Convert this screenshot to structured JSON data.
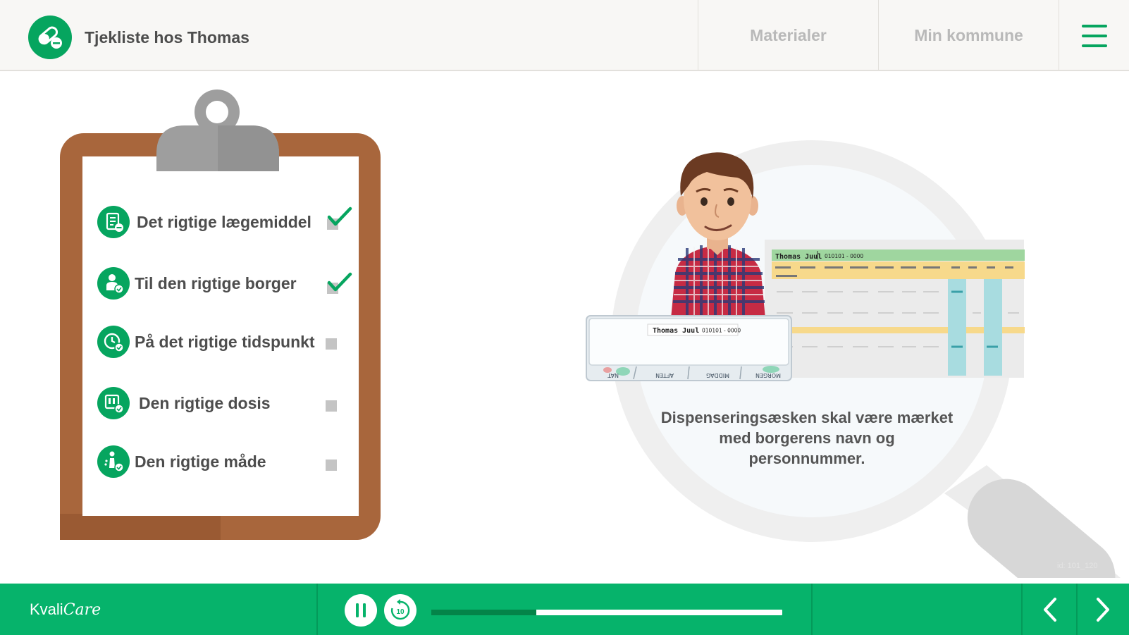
{
  "header": {
    "title": "Tjekliste hos Thomas",
    "nav": {
      "materials": "Materialer",
      "kommune": "Min kommune"
    }
  },
  "checklist": {
    "items": [
      {
        "label": "Det rigtige lægemiddel",
        "checked": true,
        "icon": "medication-list-icon"
      },
      {
        "label": "Til den rigtige borger",
        "checked": true,
        "icon": "citizen-icon"
      },
      {
        "label": "På det rigtige tidspunkt",
        "checked": false,
        "icon": "clock-icon"
      },
      {
        "label": "Den rigtige dosis",
        "checked": false,
        "icon": "dose-icon"
      },
      {
        "label": "Den rigtige måde",
        "checked": false,
        "icon": "person-method-icon"
      }
    ]
  },
  "scene": {
    "caption": "Dispenseringsæsken skal være mærket med borgerens navn og personnummer.",
    "pillbox": {
      "name": "Thomas Juul",
      "cpr": "010101 - 0000",
      "compartments": [
        "NAT",
        "AFTEN",
        "MIDDAG",
        "MORGEN"
      ]
    },
    "card": {
      "name": "Thomas Juul",
      "cpr": "010101 - 0000"
    },
    "slide_id": "id: 101_120"
  },
  "footer": {
    "brand_left": "Kvali",
    "brand_right": "Care",
    "progress": 0.3
  },
  "colors": {
    "accent": "#06b36b",
    "clipboard": "#a8663c",
    "check": "#06a55f"
  }
}
